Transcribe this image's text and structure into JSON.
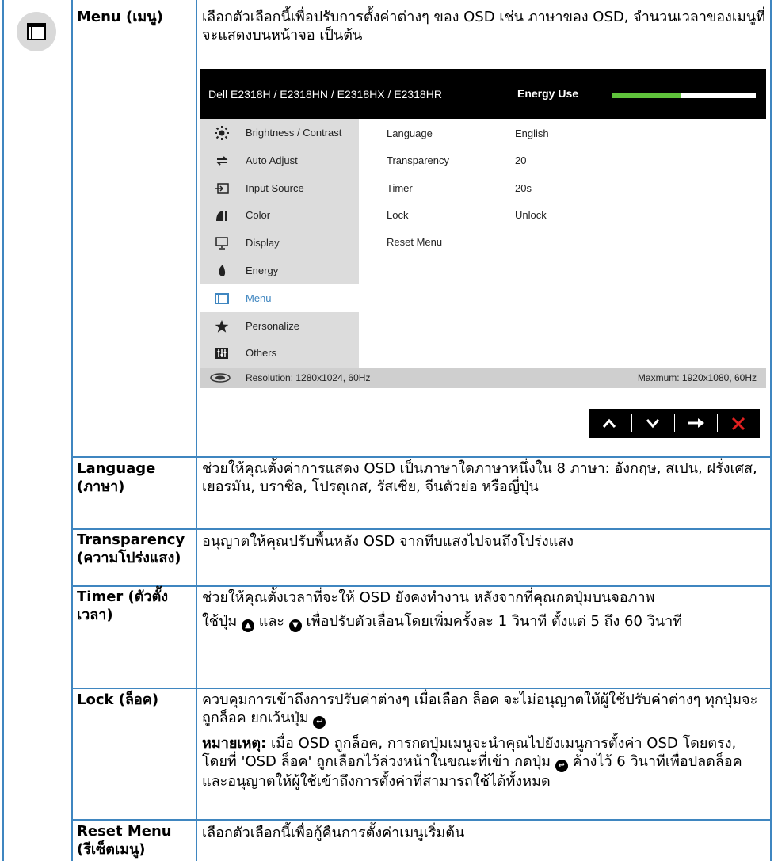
{
  "rows": {
    "menu": {
      "label": "Menu (เมนู)",
      "desc": "เลือกตัวเลือกนี้เพื่อปรับการตั้งค่าต่างๆ ของ OSD เช่น ภาษาของ OSD, จำนวนเวลาของเมนูที่จะแสดงบนหน้าจอ เป็นต้น"
    },
    "language": {
      "label": "Language (ภาษา)",
      "desc": "ช่วยให้คุณตั้งค่าการแสดง OSD เป็นภาษาใดภาษาหนึ่งใน 8 ภาษา: อังกฤษ, สเปน, ฝรั่งเศส, เยอรมัน, บราซิล, โปรตุเกส, รัสเซีย, จีนตัวย่อ หรือญี่ปุ่น"
    },
    "transparency": {
      "label": "Transparency (ความโปร่งแสง)",
      "desc": "อนุญาตให้คุณปรับพื้นหลัง OSD จากทึบแสงไปจนถึงโปร่งแสง"
    },
    "timer": {
      "label": "Timer (ตัวตั้งเวลา)",
      "desc1": "ช่วยให้คุณตั้งเวลาที่จะให้ OSD ยังคงทำงาน หลังจากที่คุณกดปุ่มบนจอภาพ",
      "desc2_a": "ใช้ปุ่ม",
      "desc2_b": "และ",
      "desc2_c": "เพื่อปรับตัวเลื่อนโดยเพิ่มครั้งละ 1 วินาที ตั้งแต่ 5 ถึง 60 วินาที"
    },
    "lock": {
      "label": "Lock (ล็อค)",
      "desc1": "ควบคุมการเข้าถึงการปรับค่าต่างๆ เมื่อเลือก ล็อค จะไม่อนุญาตให้ผู้ใช้ปรับค่าต่างๆ ทุกปุ่มจะถูกล็อค ยกเว้นปุ่ม",
      "note_label": "หมายเหตุ:",
      "note_a": "เมื่อ OSD ถูกล็อค, การกดปุ่มเมนูจะนำคุณไปยังเมนูการตั้งค่า OSD โดยตรง, โดยที่ 'OSD ล็อค' ถูกเลือกไว้ล่วงหน้าในขณะที่เข้า กดปุ่ม",
      "note_b": "ค้างไว้ 6 วินาทีเพื่อปลดล็อค และอนุญาตให้ผู้ใช้เข้าถึงการตั้งค่าที่สามารถใช้ได้ทั้งหมด"
    },
    "reset": {
      "label": "Reset Menu (รีเซ็ตเมนู)",
      "desc": "เลือกตัวเลือกนี้เพื่อกู้คืนการตั้งค่าเมนูเริ่มต้น"
    }
  },
  "osd": {
    "model": "Dell E2318H / E2318HN / E2318HX / E2318HR",
    "energy_label": "Energy Use",
    "energy_level": 0.48,
    "menu_items": [
      {
        "label": "Brightness / Contrast",
        "icon": "brightness-icon"
      },
      {
        "label": "Auto Adjust",
        "icon": "auto-adjust-icon"
      },
      {
        "label": "Input Source",
        "icon": "input-source-icon"
      },
      {
        "label": "Color",
        "icon": "color-icon"
      },
      {
        "label": "Display",
        "icon": "display-icon"
      },
      {
        "label": "Energy",
        "icon": "energy-icon"
      },
      {
        "label": "Menu",
        "icon": "menu-icon"
      },
      {
        "label": "Personalize",
        "icon": "star-icon"
      },
      {
        "label": "Others",
        "icon": "others-icon"
      }
    ],
    "active_item": "Menu",
    "settings": [
      {
        "name": "Language",
        "value": "English"
      },
      {
        "name": "Transparency",
        "value": "20"
      },
      {
        "name": "Timer",
        "value": "20s"
      },
      {
        "name": "Lock",
        "value": "Unlock"
      },
      {
        "name": "Reset Menu",
        "value": ""
      }
    ],
    "resolution": "Resolution: 1280x1024, 60Hz",
    "maximum": "Maxmum: 1920x1080, 60Hz"
  },
  "nav_buttons": [
    "up-arrow-icon",
    "down-arrow-icon",
    "right-arrow-icon",
    "close-icon"
  ],
  "colors": {
    "border": "#3f86c0",
    "energy_bar": "#5fc23b",
    "close": "#e02020"
  }
}
